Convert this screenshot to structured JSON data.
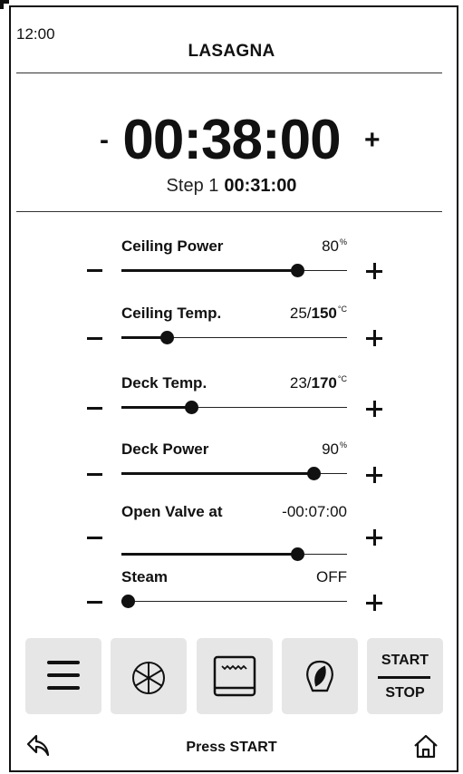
{
  "status": {
    "time": "12:00"
  },
  "program": {
    "name": "LASAGNA"
  },
  "timer": {
    "total": "00:38:00",
    "minus": "-",
    "plus": "+"
  },
  "step": {
    "label": "Step 1",
    "time": "00:31:00"
  },
  "settings": [
    {
      "label": "Ceiling Power",
      "value": "80",
      "unit": "%",
      "level": 0.78
    },
    {
      "label": "Ceiling Temp.",
      "value": "25/",
      "value_bold": "150",
      "unit": "°C",
      "level": 0.2
    },
    {
      "label": "Deck Temp.",
      "value": "23/",
      "value_bold": "170",
      "unit": "°C",
      "level": 0.31
    },
    {
      "label": "Deck Power",
      "value": "90",
      "unit": "%",
      "level": 0.85
    },
    {
      "label": "Open Valve at",
      "value": "-00:07:00",
      "unit": "",
      "level": 0.78
    },
    {
      "label": "Steam",
      "value": "OFF",
      "unit": "",
      "level": 0.03
    }
  ],
  "toolbar": {
    "items": [
      {
        "icon": "menu-icon"
      },
      {
        "icon": "fan-icon"
      },
      {
        "icon": "oven-icon"
      },
      {
        "icon": "eco-leaf-icon"
      }
    ],
    "start_label": "START",
    "stop_label": "STOP"
  },
  "footer": {
    "message": "Press START",
    "back_icon": "back-arrow-icon",
    "home_icon": "home-icon"
  }
}
